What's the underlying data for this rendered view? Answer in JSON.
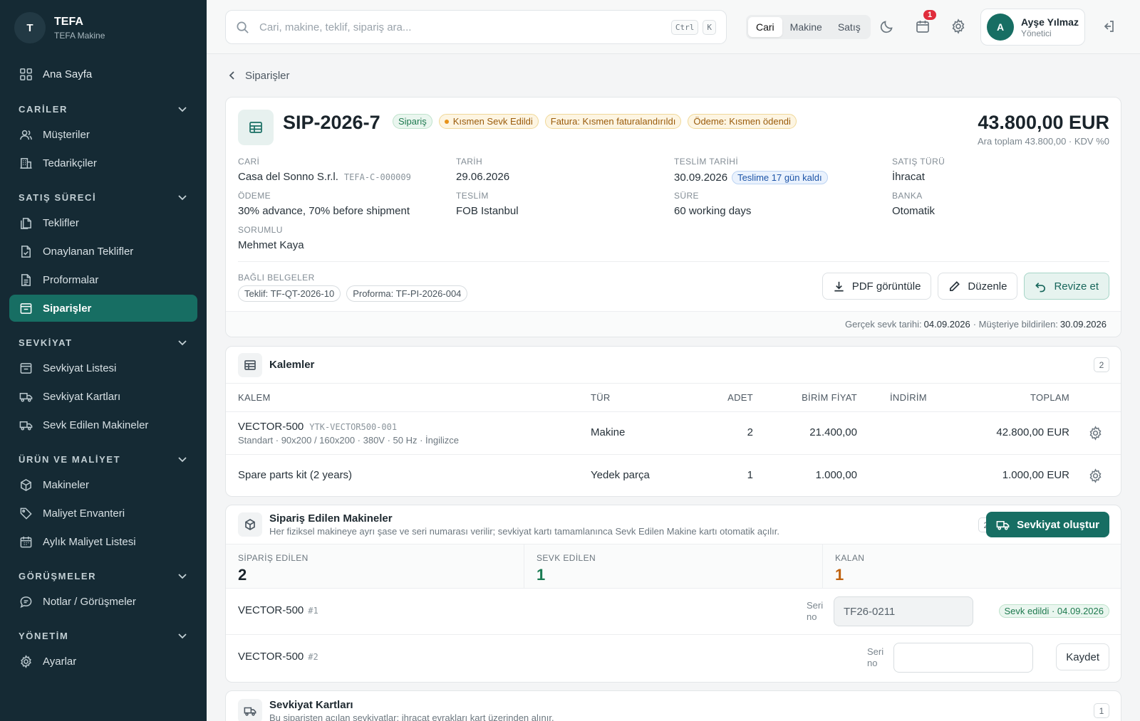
{
  "brand": {
    "initial": "T",
    "title": "TEFA",
    "subtitle": "TEFA Makine"
  },
  "sidebar": {
    "home": "Ana Sayfa",
    "sections": [
      {
        "title": "CARİLER",
        "items": [
          "Müşteriler",
          "Tedarikçiler"
        ]
      },
      {
        "title": "SATIŞ SÜRECİ",
        "items": [
          "Teklifler",
          "Onaylanan Teklifler",
          "Proformalar",
          "Siparişler"
        ]
      },
      {
        "title": "SEVKİYAT",
        "items": [
          "Sevkiyat Listesi",
          "Sevkiyat Kartları",
          "Sevk Edilen Makineler"
        ]
      },
      {
        "title": "ÜRÜN VE MALİYET",
        "items": [
          "Makineler",
          "Maliyet Envanteri",
          "Aylık Maliyet Listesi"
        ]
      },
      {
        "title": "GÖRÜŞMELER",
        "items": [
          "Notlar / Görüşmeler"
        ]
      },
      {
        "title": "YÖNETİM",
        "items": [
          "Ayarlar"
        ]
      }
    ],
    "active_item": "Siparişler"
  },
  "topbar": {
    "search_placeholder": "Cari, makine, teklif, sipariş ara...",
    "kbd_ctrl": "Ctrl",
    "kbd_k": "K",
    "scope_tabs": [
      "Cari",
      "Makine",
      "Satış"
    ],
    "active_scope": "Cari",
    "notification_count": "1",
    "user": {
      "initial": "A",
      "name": "Ayşe Yılmaz",
      "role": "Yönetici"
    }
  },
  "breadcrumb": "Siparişler",
  "order": {
    "number": "SIP-2026-7",
    "badges": {
      "type": "Sipariş",
      "shipping": "Kısmen Sevk Edildi",
      "invoice": "Fatura: Kısmen faturalandırıldı",
      "payment": "Ödeme: Kısmen ödendi"
    },
    "total": "43.800,00 EUR",
    "subtotal": "Ara toplam 43.800,00 · KDV %0",
    "fields": {
      "cari_label": "CARİ",
      "cari_value": "Casa del Sonno S.r.l.",
      "cari_code": "TEFA-C-000009",
      "tarih_label": "TARİH",
      "tarih_value": "29.06.2026",
      "teslim_tarihi_label": "TESLİM TARİHİ",
      "teslim_tarihi_value": "30.09.2026",
      "teslim_badge": "Teslime 17 gün kaldı",
      "satis_turu_label": "SATIŞ TÜRÜ",
      "satis_turu_value": "İhracat",
      "odeme_label": "ÖDEME",
      "odeme_value": "30% advance, 70% before shipment",
      "teslim_label": "TESLİM",
      "teslim_value": "FOB Istanbul",
      "sure_label": "SÜRE",
      "sure_value": "60 working days",
      "banka_label": "BANKA",
      "banka_value": "Otomatik",
      "sorumlu_label": "SORUMLU",
      "sorumlu_value": "Mehmet Kaya"
    },
    "linked_label": "BAĞLI BELGELER",
    "linked_docs": [
      "Teklif: TF-QT-2026-10",
      "Proforma: TF-PI-2026-004"
    ],
    "actions": {
      "pdf": "PDF görüntüle",
      "edit": "Düzenle",
      "revise": "Revize et"
    },
    "footer": {
      "actual_label": "Gerçek sevk tarihi:",
      "actual_value": "04.09.2026",
      "notified_label": "· Müşteriye bildirilen:",
      "notified_value": "30.09.2026"
    }
  },
  "items": {
    "title": "Kalemler",
    "count": "2",
    "columns": {
      "item": "KALEM",
      "type": "TÜR",
      "qty": "ADET",
      "unit_price": "BİRİM FİYAT",
      "discount": "İNDİRİM",
      "total": "TOPLAM"
    },
    "rows": [
      {
        "name": "VECTOR-500",
        "code": "YTK-VECTOR500-001",
        "sub": "Standart · 90x200 / 160x200 · 380V · 50 Hz · İngilizce",
        "type": "Makine",
        "qty": "2",
        "unit_price": "21.400,00",
        "discount": "",
        "total": "42.800,00 EUR"
      },
      {
        "name": "Spare parts kit (2 years)",
        "code": "",
        "sub": "",
        "type": "Yedek parça",
        "qty": "1",
        "unit_price": "1.000,00",
        "discount": "",
        "total": "1.000,00 EUR"
      }
    ]
  },
  "machines": {
    "title": "Sipariş Edilen Makineler",
    "subtitle": "Her fiziksel makineye ayrı şase ve seri numarası verilir; sevkiyat kartı tamamlanınca Sevk Edilen Makine kartı otomatik açılır.",
    "count": "2",
    "create_button": "Sevkiyat oluştur",
    "stats": {
      "ordered_label": "SİPARİŞ EDİLEN",
      "ordered_value": "2",
      "shipped_label": "SEVK EDİLEN",
      "shipped_value": "1",
      "remaining_label": "KALAN",
      "remaining_value": "1"
    },
    "seri_label_1": "Seri",
    "seri_label_2": "no",
    "rows": [
      {
        "name": "VECTOR-500",
        "index": "#1",
        "serial": "TF26-0211",
        "status": "Sevk edildi · 04.09.2026"
      },
      {
        "name": "VECTOR-500",
        "index": "#2",
        "serial": "",
        "save": "Kaydet"
      }
    ]
  },
  "shipment_cards": {
    "title": "Sevkiyat Kartları",
    "subtitle": "Bu siparişten açılan sevkiyatlar; ihracat evrakları kart üzerinden alınır.",
    "count": "1"
  }
}
